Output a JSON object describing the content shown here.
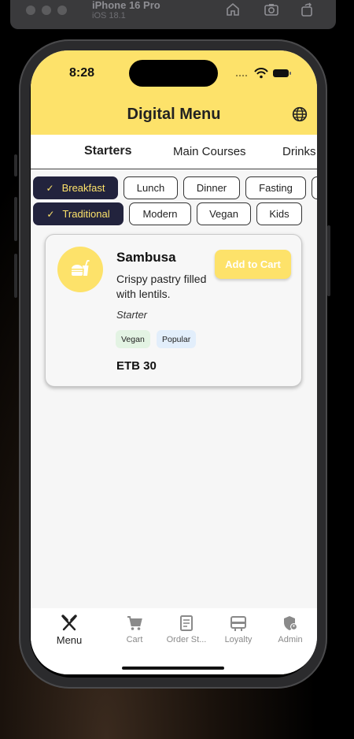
{
  "simulator": {
    "device": "iPhone 16 Pro",
    "os": "iOS 18.1"
  },
  "status_bar": {
    "time": "8:28"
  },
  "header": {
    "title": "Digital Menu"
  },
  "tabs": [
    {
      "label": "Starters",
      "active": true
    },
    {
      "label": "Main Courses",
      "active": false
    },
    {
      "label": "Drinks",
      "active": false
    }
  ],
  "meal_filters": [
    {
      "label": "Breakfast",
      "selected": true
    },
    {
      "label": "Lunch",
      "selected": false
    },
    {
      "label": "Dinner",
      "selected": false
    },
    {
      "label": "Fasting",
      "selected": false
    }
  ],
  "style_filters": [
    {
      "label": "Traditional",
      "selected": true
    },
    {
      "label": "Modern",
      "selected": false
    },
    {
      "label": "Vegan",
      "selected": false
    },
    {
      "label": "Kids",
      "selected": false
    }
  ],
  "menu_item": {
    "name": "Sambusa",
    "description": "Crispy pastry filled with lentils.",
    "category": "Starter",
    "tags": [
      "Vegan",
      "Popular"
    ],
    "price": "ETB 30",
    "add_button": "Add to Cart"
  },
  "bottom_nav": [
    {
      "label": "Menu",
      "icon": "fork-knife-icon",
      "active": true
    },
    {
      "label": "Cart",
      "icon": "cart-icon",
      "active": false
    },
    {
      "label": "Order St...",
      "icon": "receipt-icon",
      "active": false
    },
    {
      "label": "Loyalty",
      "icon": "card-icon",
      "active": false
    },
    {
      "label": "Admin",
      "icon": "admin-shield-icon",
      "active": false
    }
  ],
  "colors": {
    "accent_yellow": "#fde26a",
    "chip_selected_bg": "#22233d",
    "background": "#f6f6f6"
  }
}
